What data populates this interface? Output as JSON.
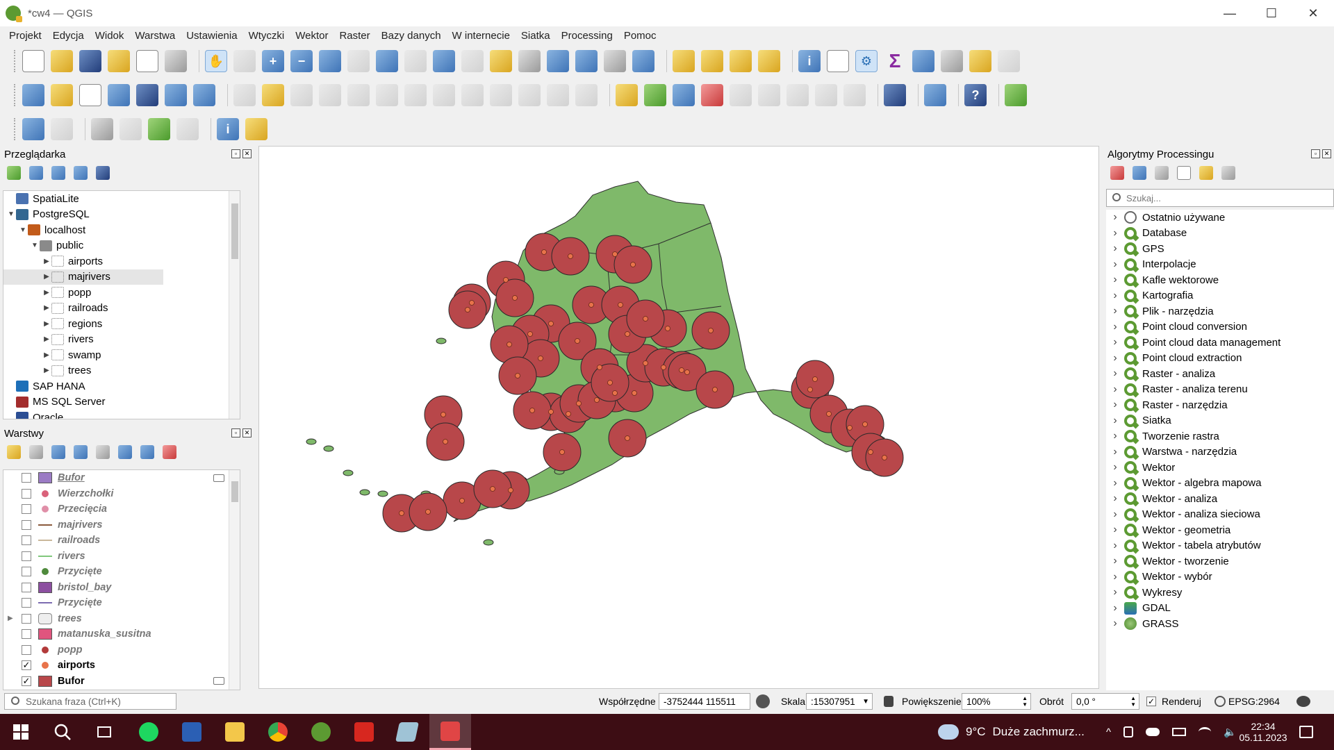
{
  "window": {
    "title": "*cw4 — QGIS",
    "minimize_glyph": "—",
    "maximize_glyph": "☐",
    "close_glyph": "✕"
  },
  "menu": [
    "Projekt",
    "Edycja",
    "Widok",
    "Warstwa",
    "Ustawienia",
    "Wtyczki",
    "Wektor",
    "Raster",
    "Bazy danych",
    "W internecie",
    "Siatka",
    "Processing",
    "Pomoc"
  ],
  "browser": {
    "title": "Przeglądarka",
    "items": [
      {
        "label": "SpatiaLite",
        "level": 0,
        "icon": "spatialite-icon",
        "expander": ""
      },
      {
        "label": "PostgreSQL",
        "level": 0,
        "icon": "postgresql-icon",
        "expander": "▼"
      },
      {
        "label": "localhost",
        "level": 1,
        "icon": "server-icon",
        "expander": "▼"
      },
      {
        "label": "public",
        "level": 2,
        "icon": "schema-icon",
        "expander": "▼"
      },
      {
        "label": "airports",
        "level": 3,
        "icon": "point-layer-icon",
        "expander": "▶"
      },
      {
        "label": "majrivers",
        "level": 3,
        "icon": "line-layer-icon",
        "expander": "▶",
        "selected": true
      },
      {
        "label": "popp",
        "level": 3,
        "icon": "point-layer-icon",
        "expander": "▶"
      },
      {
        "label": "railroads",
        "level": 3,
        "icon": "line-layer-icon",
        "expander": "▶"
      },
      {
        "label": "regions",
        "level": 3,
        "icon": "polygon-layer-icon",
        "expander": "▶"
      },
      {
        "label": "rivers",
        "level": 3,
        "icon": "line-layer-icon",
        "expander": "▶"
      },
      {
        "label": "swamp",
        "level": 3,
        "icon": "polygon-layer-icon",
        "expander": "▶"
      },
      {
        "label": "trees",
        "level": 3,
        "icon": "polygon-layer-icon",
        "expander": "▶"
      },
      {
        "label": "SAP HANA",
        "level": 0,
        "icon": "sap-hana-icon",
        "expander": ""
      },
      {
        "label": "MS SQL Server",
        "level": 0,
        "icon": "mssql-icon",
        "expander": ""
      },
      {
        "label": "Oracle",
        "level": 0,
        "icon": "oracle-icon",
        "expander": ""
      }
    ]
  },
  "layers": {
    "title": "Warstwy",
    "items": [
      {
        "label": "Bufor",
        "checked": false,
        "symbol": "fill",
        "color": "#9b7bc4",
        "underline": true
      },
      {
        "label": "Wierzchołki",
        "checked": false,
        "symbol": "point",
        "color": "#d9627a"
      },
      {
        "label": "Przecięcia",
        "checked": false,
        "symbol": "point",
        "color": "#e08fa8"
      },
      {
        "label": "majrivers",
        "checked": false,
        "symbol": "line",
        "color": "#8b5a3c"
      },
      {
        "label": "railroads",
        "checked": false,
        "symbol": "line",
        "color": "#c9b79a"
      },
      {
        "label": "rivers",
        "checked": false,
        "symbol": "line",
        "color": "#7fc77b"
      },
      {
        "label": "Przycięte",
        "checked": false,
        "symbol": "point",
        "color": "#4f8a3c"
      },
      {
        "label": "bristol_bay",
        "checked": false,
        "symbol": "fill",
        "color": "#8c4fa0"
      },
      {
        "label": "Przycięte",
        "checked": false,
        "symbol": "line",
        "color": "#7c6bb0"
      },
      {
        "label": "trees",
        "checked": false,
        "symbol": "group",
        "color": "#cccccc",
        "expander": "▶"
      },
      {
        "label": "matanuska_susitna",
        "checked": false,
        "symbol": "fill",
        "color": "#e0557e"
      },
      {
        "label": "popp",
        "checked": false,
        "symbol": "point",
        "color": "#b23a3a"
      },
      {
        "label": "airports",
        "checked": true,
        "symbol": "point",
        "color": "#e8734a"
      },
      {
        "label": "Bufor",
        "checked": true,
        "symbol": "fill",
        "color": "#b8474a"
      }
    ]
  },
  "processing": {
    "title": "Algorytmy Processingu",
    "search_placeholder": "Szukaj...",
    "items": [
      {
        "label": "Ostatnio używane",
        "icon": "clock-icon"
      },
      {
        "label": "Database",
        "icon": "qgis-icon"
      },
      {
        "label": "GPS",
        "icon": "qgis-icon"
      },
      {
        "label": "Interpolacje",
        "icon": "qgis-icon"
      },
      {
        "label": "Kafle wektorowe",
        "icon": "qgis-icon"
      },
      {
        "label": "Kartografia",
        "icon": "qgis-icon"
      },
      {
        "label": "Plik - narzędzia",
        "icon": "qgis-icon"
      },
      {
        "label": "Point cloud conversion",
        "icon": "qgis-icon"
      },
      {
        "label": "Point cloud data management",
        "icon": "qgis-icon"
      },
      {
        "label": "Point cloud extraction",
        "icon": "qgis-icon"
      },
      {
        "label": "Raster - analiza",
        "icon": "qgis-icon"
      },
      {
        "label": "Raster - analiza terenu",
        "icon": "qgis-icon"
      },
      {
        "label": "Raster - narzędzia",
        "icon": "qgis-icon"
      },
      {
        "label": "Siatka",
        "icon": "qgis-icon"
      },
      {
        "label": "Tworzenie rastra",
        "icon": "qgis-icon"
      },
      {
        "label": "Warstwa - narzędzia",
        "icon": "qgis-icon"
      },
      {
        "label": "Wektor",
        "icon": "qgis-icon"
      },
      {
        "label": "Wektor - algebra mapowa",
        "icon": "qgis-icon"
      },
      {
        "label": "Wektor - analiza",
        "icon": "qgis-icon"
      },
      {
        "label": "Wektor - analiza sieciowa",
        "icon": "qgis-icon"
      },
      {
        "label": "Wektor - geometria",
        "icon": "qgis-icon"
      },
      {
        "label": "Wektor - tabela atrybutów",
        "icon": "qgis-icon"
      },
      {
        "label": "Wektor - tworzenie",
        "icon": "qgis-icon"
      },
      {
        "label": "Wektor - wybór",
        "icon": "qgis-icon"
      },
      {
        "label": "Wykresy",
        "icon": "qgis-icon"
      },
      {
        "label": "GDAL",
        "icon": "gdal-icon"
      },
      {
        "label": "GRASS",
        "icon": "grass-icon"
      }
    ]
  },
  "map": {
    "land_color": "#7fb96a",
    "buffer_color": "#b8474a",
    "point_color": "#e8734a"
  },
  "statusbar": {
    "locator_placeholder": "Szukana fraza (Ctrl+K)",
    "coord_label": "Współrzędne",
    "coord_value": "-3752444  115511",
    "scale_label": "Skala",
    "scale_value": ":15307951",
    "magnifier_label": "Powiększenie",
    "magnifier_value": "100%",
    "rotation_label": "Obrót",
    "rotation_value": "0,0 °",
    "render_label": "Renderuj",
    "render_checked": true,
    "crs_label": "EPSG:2964"
  },
  "taskbar": {
    "weather_temp": "9°C",
    "weather_text": "Duże zachmurz...",
    "time": "22:34",
    "date": "05.11.2023"
  }
}
